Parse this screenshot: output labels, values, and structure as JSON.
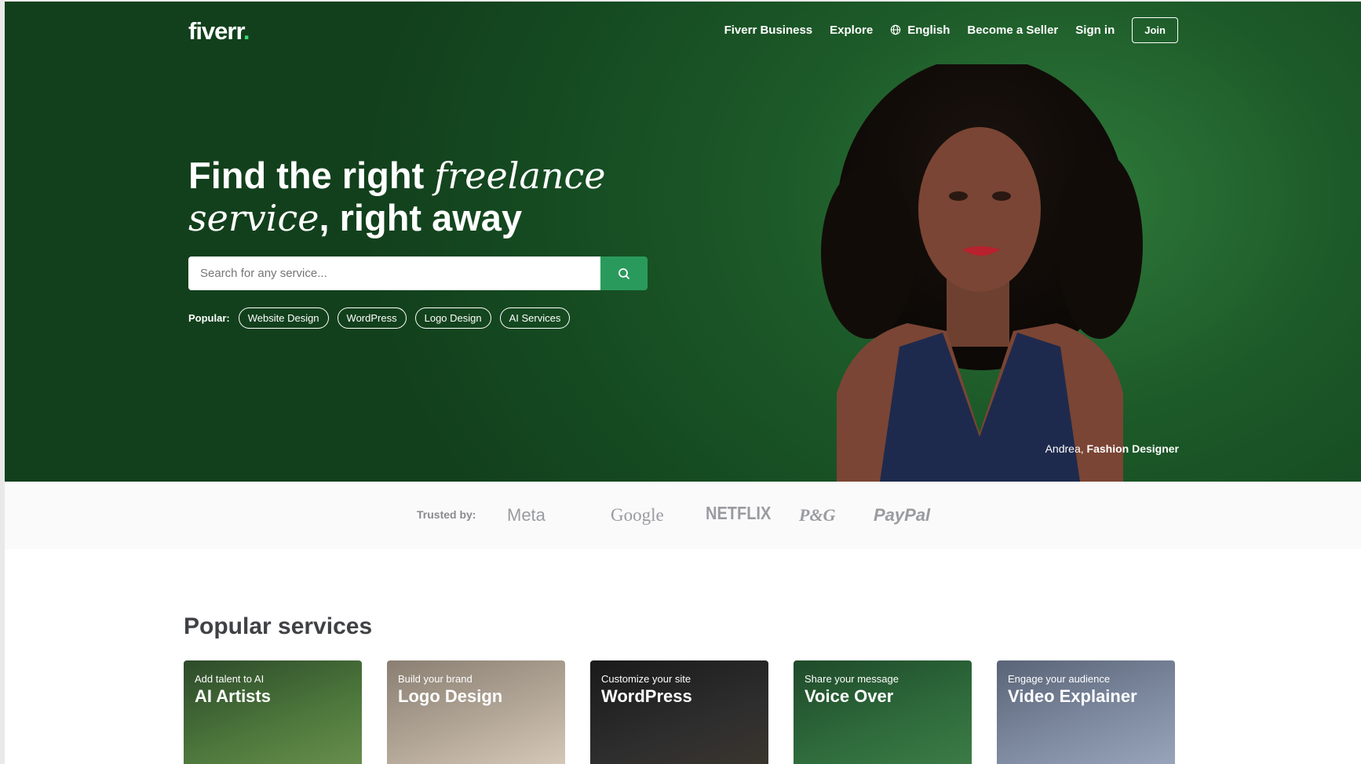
{
  "header": {
    "logo_text": "fiverr",
    "logo_dot": ".",
    "nav": {
      "business": "Fiverr Business",
      "explore": "Explore",
      "language": "English",
      "become_seller": "Become a Seller",
      "sign_in": "Sign in",
      "join": "Join"
    }
  },
  "hero": {
    "headline_1": "Find the right ",
    "headline_1_italic": "freelance",
    "headline_2_italic": "service",
    "headline_2": ", right away",
    "search_placeholder": "Search for any service...",
    "popular_label": "Popular:",
    "popular_tags": [
      "Website Design",
      "WordPress",
      "Logo Design",
      "AI Services"
    ],
    "caption_name": "Andrea,",
    "caption_role": "Fashion Designer"
  },
  "trusted": {
    "label": "Trusted by:",
    "brands": [
      "Meta",
      "Google",
      "NETFLIX",
      "P&G",
      "PayPal"
    ]
  },
  "popular_services": {
    "title": "Popular services",
    "cards": [
      {
        "subtitle": "Add talent to AI",
        "title": "AI Artists"
      },
      {
        "subtitle": "Build your brand",
        "title": "Logo Design"
      },
      {
        "subtitle": "Customize your site",
        "title": "WordPress"
      },
      {
        "subtitle": "Share your message",
        "title": "Voice Over"
      },
      {
        "subtitle": "Engage your audience",
        "title": "Video Explainer"
      }
    ]
  },
  "colors": {
    "hero_green": "#1d5a29",
    "search_button": "#2a9a5c",
    "logo_dot": "#3cdb7b"
  }
}
